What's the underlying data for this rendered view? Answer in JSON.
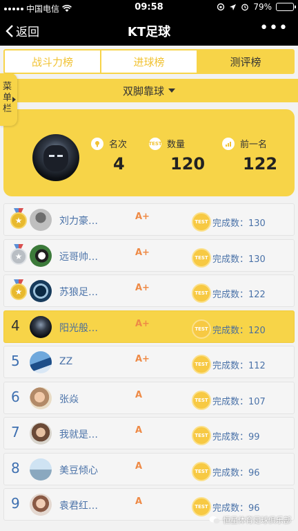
{
  "status_bar": {
    "carrier": "中国电信",
    "time": "09:58",
    "battery_text": "79%",
    "battery_level": 0.79
  },
  "nav": {
    "back_label": "返回",
    "title": "KT足球",
    "more_label": "•••"
  },
  "tabs": [
    {
      "label": "战斗力榜",
      "active": false
    },
    {
      "label": "进球榜",
      "active": false
    },
    {
      "label": "测评榜",
      "active": true
    }
  ],
  "side_menu": {
    "label_1": "菜",
    "label_2": "单",
    "label_3": "栏"
  },
  "filter": {
    "selected": "双脚靠球"
  },
  "summary": {
    "rank_label": "名次",
    "rank_value": "4",
    "count_label": "数量",
    "count_value": "120",
    "prev_label": "前一名",
    "prev_value": "122",
    "test_icon_text": "TEST"
  },
  "list": {
    "done_prefix": "完成数：",
    "test_icon_text": "TEST",
    "rows": [
      {
        "rank": "",
        "medal": "gold",
        "name": "刘力豪…",
        "grade": "A+",
        "done": "完成数：130"
      },
      {
        "rank": "",
        "medal": "silver",
        "name": "远哥帅…",
        "grade": "A+",
        "done": "完成数：130"
      },
      {
        "rank": "",
        "medal": "gold",
        "name": "苏狼足…",
        "grade": "A+",
        "done": "完成数：122"
      },
      {
        "rank": "4",
        "medal": "",
        "name": "阳光般…",
        "grade": "A+",
        "done": "完成数：120"
      },
      {
        "rank": "5",
        "medal": "",
        "name": "ZZ",
        "grade": "A+",
        "done": "完成数：112"
      },
      {
        "rank": "6",
        "medal": "",
        "name": "张焱",
        "grade": "A",
        "done": "完成数：107"
      },
      {
        "rank": "7",
        "medal": "",
        "name": "我就是…",
        "grade": "A",
        "done": "完成数：99"
      },
      {
        "rank": "8",
        "medal": "",
        "name": "美豆倾心",
        "grade": "A",
        "done": "完成数：96"
      },
      {
        "rank": "9",
        "medal": "",
        "name": "袁君红…",
        "grade": "A",
        "done": "完成数：96"
      }
    ]
  },
  "watermark": "恒星体育足球俱乐部",
  "colors": {
    "accent": "#f7d448",
    "link_blue": "#4a72a8",
    "grade_orange": "#ee8a46"
  }
}
